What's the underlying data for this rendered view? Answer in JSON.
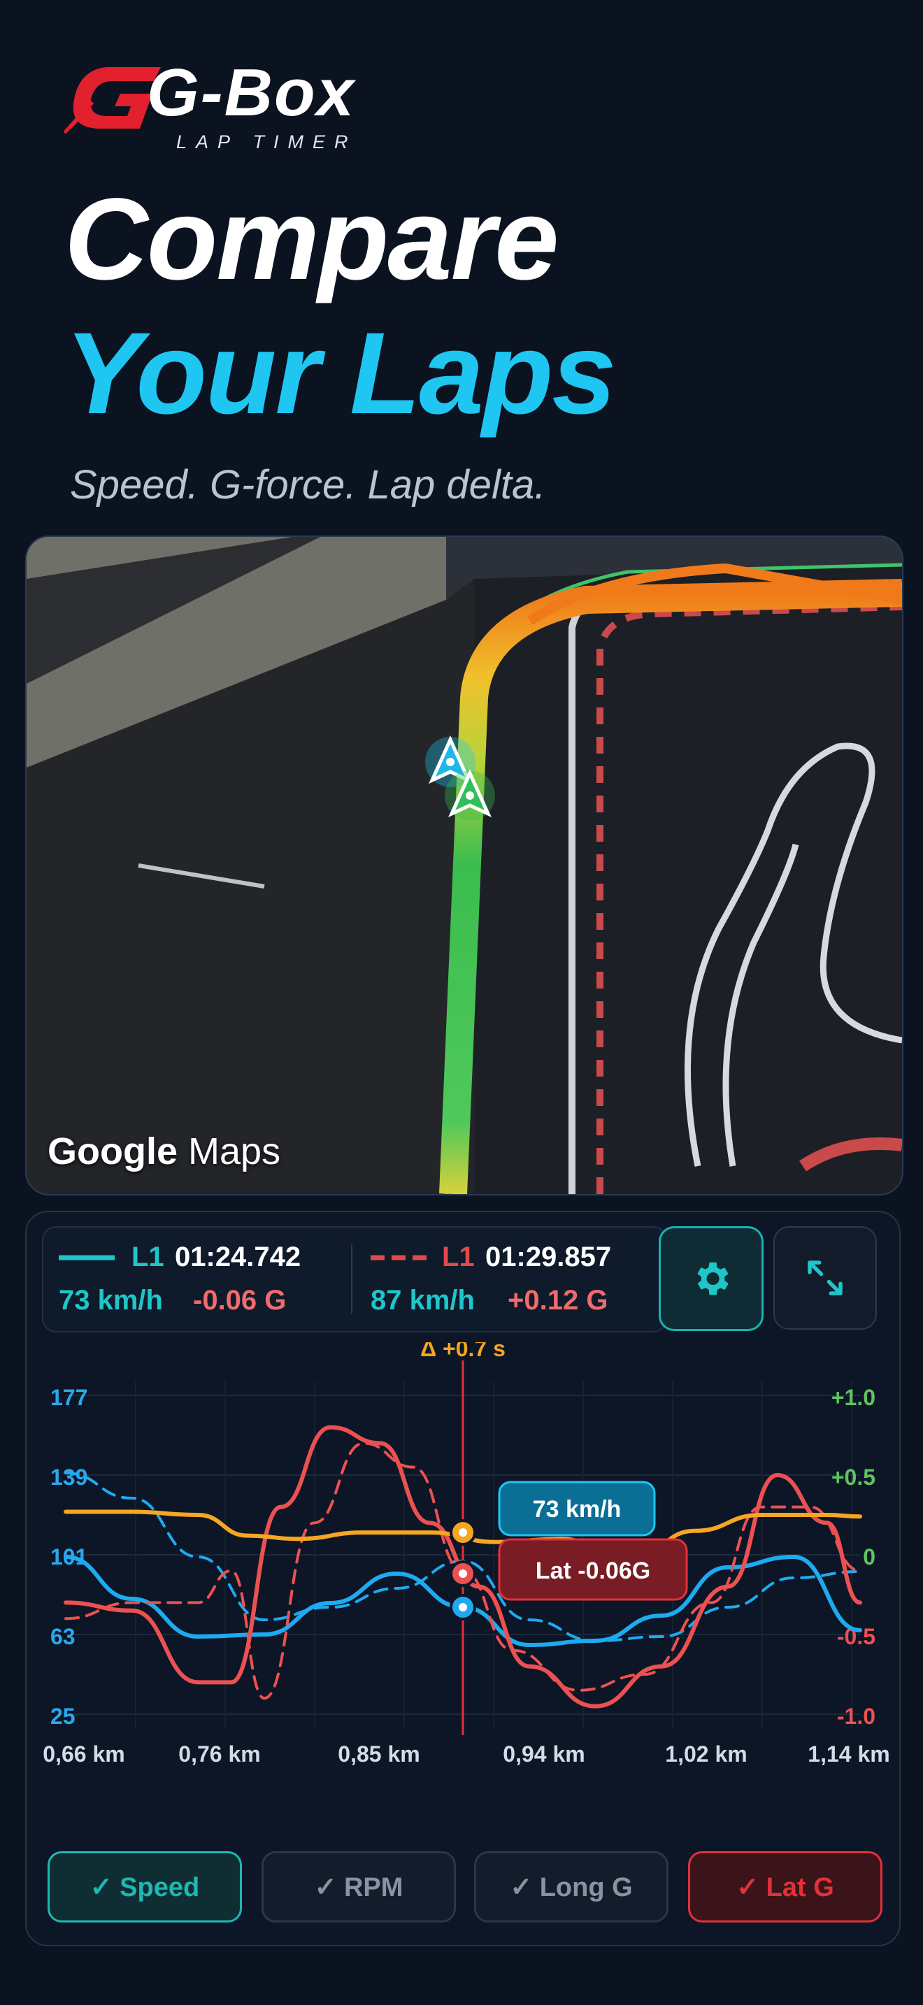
{
  "brand": {
    "name": "G-Box",
    "subtitle": "LAP TIMER",
    "accent": "#e2202e"
  },
  "headline": {
    "line1": "Compare",
    "line2": "Your Laps",
    "tagline": "Speed. G-force. Lap delta."
  },
  "map": {
    "attribution_prefix": "Google",
    "attribution_suffix": "Maps"
  },
  "legend": {
    "lap1": {
      "label": "L1",
      "time": "01:24.742",
      "speed": "73 km/h",
      "g": "-0.06 G",
      "color": "#1fc6c9"
    },
    "lap2": {
      "label": "L1",
      "time": "01:29.857",
      "speed": "87 km/h",
      "g": "+0.12 G",
      "color": "#e24a4a"
    }
  },
  "icons": {
    "settings": "gear-icon",
    "expand": "expand-icon"
  },
  "chart_data": {
    "type": "line",
    "delta_label": "Δ +0.7 s",
    "x_ticks": [
      "0,66 km",
      "0,76 km",
      "0,85 km",
      "0,94 km",
      "1,02 km",
      "1,14 km"
    ],
    "y_left_ticks": [
      "177",
      "139",
      "101",
      "63",
      "25"
    ],
    "y_left_range": [
      25,
      177
    ],
    "y_right_ticks": [
      "+1.0",
      "+0.5",
      "0",
      "-0.5",
      "-1.0"
    ],
    "y_right_range": [
      -1.0,
      1.0
    ],
    "x_range": [
      0.66,
      1.14
    ],
    "cursor_x": 0.9,
    "tooltips": {
      "speed": "73 km/h",
      "lat": "Lat -0.06G"
    },
    "series": [
      {
        "name": "Speed",
        "axis": "left",
        "color": "#1eaaf0",
        "dash": false,
        "x": [
          0.66,
          0.7,
          0.74,
          0.78,
          0.82,
          0.86,
          0.9,
          0.94,
          0.98,
          1.02,
          1.06,
          1.1,
          1.14
        ],
        "y": [
          100,
          80,
          62,
          63,
          78,
          92,
          76,
          58,
          60,
          72,
          95,
          100,
          65
        ]
      },
      {
        "name": "",
        "axis": "left",
        "color": "#1eaaf0",
        "dash": true,
        "x": [
          0.66,
          0.7,
          0.74,
          0.78,
          0.82,
          0.86,
          0.9,
          0.94,
          0.98,
          1.02,
          1.06,
          1.1,
          1.14
        ],
        "y": [
          140,
          128,
          100,
          70,
          76,
          85,
          98,
          70,
          60,
          62,
          76,
          90,
          93
        ]
      },
      {
        "name": "Lat G",
        "axis": "right",
        "color": "#ec5151",
        "dash": false,
        "x": [
          0.66,
          0.7,
          0.74,
          0.76,
          0.79,
          0.82,
          0.85,
          0.88,
          0.91,
          0.94,
          0.98,
          1.02,
          1.06,
          1.09,
          1.12,
          1.14
        ],
        "y": [
          -0.3,
          -0.35,
          -0.8,
          -0.8,
          0.3,
          0.8,
          0.7,
          0.2,
          -0.2,
          -0.7,
          -0.95,
          -0.7,
          -0.2,
          0.5,
          0.2,
          -0.3
        ]
      },
      {
        "name": "",
        "axis": "right",
        "color": "#ec5151",
        "dash": true,
        "x": [
          0.66,
          0.7,
          0.74,
          0.76,
          0.78,
          0.81,
          0.84,
          0.87,
          0.9,
          0.93,
          0.97,
          1.01,
          1.05,
          1.08,
          1.11,
          1.14
        ],
        "y": [
          -0.4,
          -0.3,
          -0.3,
          -0.1,
          -0.9,
          0.2,
          0.7,
          0.55,
          -0.1,
          -0.6,
          -0.85,
          -0.75,
          -0.3,
          0.3,
          0.3,
          -0.1
        ]
      },
      {
        "name": "Long G",
        "axis": "right",
        "color": "#f5a623",
        "dash": false,
        "x": [
          0.66,
          0.7,
          0.74,
          0.77,
          0.8,
          0.84,
          0.88,
          0.92,
          0.96,
          1.0,
          1.04,
          1.08,
          1.12,
          1.14
        ],
        "y": [
          0.27,
          0.27,
          0.25,
          0.12,
          0.1,
          0.14,
          0.14,
          0.08,
          0.1,
          -0.05,
          0.15,
          0.25,
          0.25,
          0.24
        ]
      }
    ]
  },
  "toggles": [
    {
      "label": "✓ Speed",
      "state": "on",
      "color": "#1fb7b2"
    },
    {
      "label": "✓ RPM",
      "state": "off",
      "color": "#7f8a99"
    },
    {
      "label": "✓ Long G",
      "state": "off",
      "color": "#7f8a99"
    },
    {
      "label": "✓ Lat G",
      "state": "on",
      "color": "#e2313a"
    }
  ]
}
